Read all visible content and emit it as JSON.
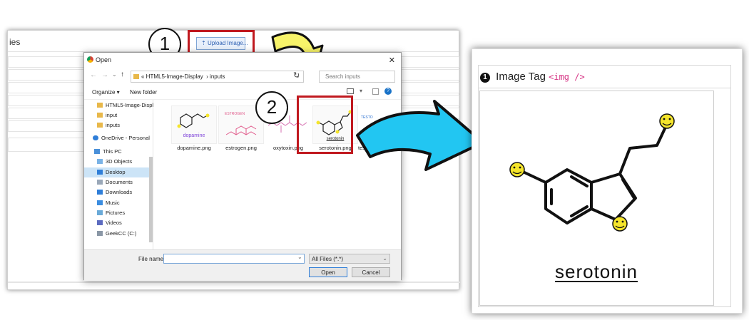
{
  "background_app": {
    "title_fragment": "ies"
  },
  "upload_button": {
    "label": "Upload Image..."
  },
  "steps": {
    "one": "1",
    "two": "2"
  },
  "dialog": {
    "title": "Open",
    "breadcrumb": [
      "HTML5-Image-Display",
      "inputs"
    ],
    "search_placeholder": "Search inputs",
    "organize": "Organize ▾",
    "new_folder": "New folder",
    "tree": [
      {
        "label": "HTML5-Image-Displ",
        "icon": "folder-icon"
      },
      {
        "label": "input",
        "icon": "folder-icon"
      },
      {
        "label": "inputs",
        "icon": "folder-icon"
      },
      {
        "label": "OneDrive - Personal",
        "icon": "cloud-icon"
      },
      {
        "label": "This PC",
        "icon": "pc-icon"
      },
      {
        "label": "3D Objects",
        "icon": "cube-icon"
      },
      {
        "label": "Desktop",
        "icon": "desktop-icon"
      },
      {
        "label": "Documents",
        "icon": "document-icon"
      },
      {
        "label": "Downloads",
        "icon": "download-icon"
      },
      {
        "label": "Music",
        "icon": "music-icon"
      },
      {
        "label": "Pictures",
        "icon": "picture-icon"
      },
      {
        "label": "Videos",
        "icon": "video-icon"
      },
      {
        "label": "GeekCC (C:)",
        "icon": "drive-icon"
      }
    ],
    "files": [
      {
        "name": "dopamine.png",
        "thumb_text": "dopamine"
      },
      {
        "name": "estrogen.png",
        "thumb_text": "ESTROGEN"
      },
      {
        "name": "oxytoxin.png",
        "thumb_text": ""
      },
      {
        "name": "serotonin.png",
        "thumb_text": "serotonin"
      },
      {
        "name": "testerone.png",
        "thumb_text": "TESTO"
      }
    ],
    "file_name_label": "File name:",
    "file_name_value": "",
    "filter": "All Files (*.*)",
    "open": "Open",
    "cancel": "Cancel"
  },
  "result_panel": {
    "number": "1",
    "title": "Image Tag",
    "code": "<img />",
    "image_label": "serotonin"
  },
  "colors": {
    "highlight_red": "#c0191f",
    "arrow_yellow": "#f7f36a",
    "arrow_cyan": "#22c6f2",
    "smiley": "#f5e52b"
  }
}
